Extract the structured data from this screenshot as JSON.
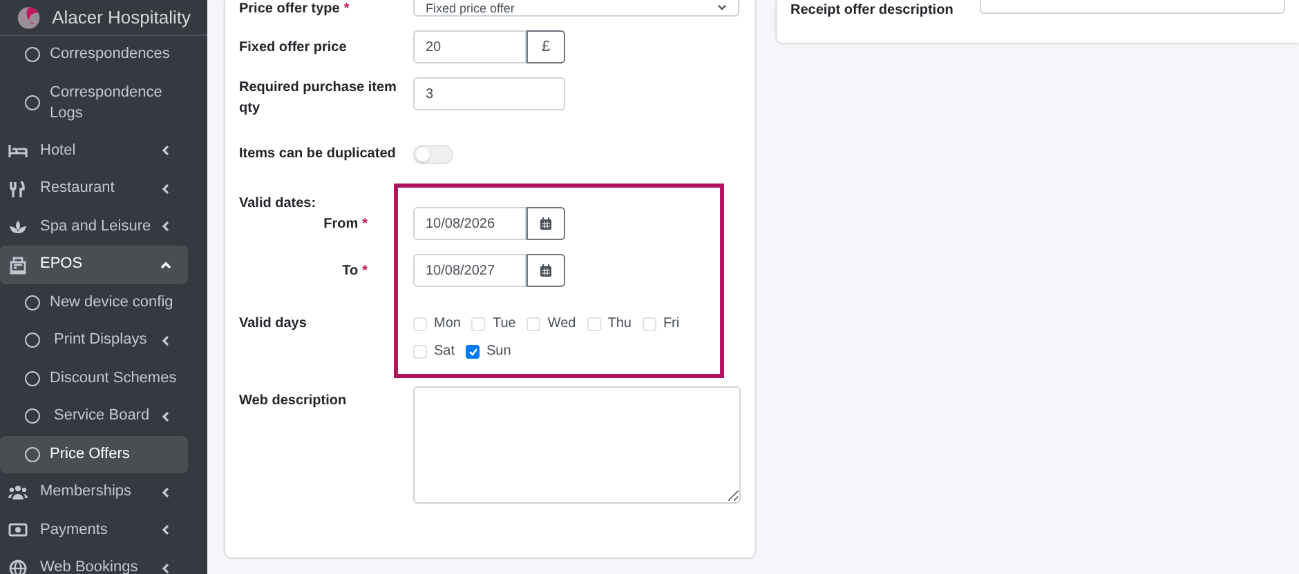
{
  "brand": {
    "name": "Alacer Hospitality"
  },
  "sidebar": {
    "items": [
      {
        "kind": "sub",
        "label": "Correspondences",
        "selected": false
      },
      {
        "kind": "sub",
        "label": "Correspondence Logs",
        "selected": false
      },
      {
        "kind": "main",
        "label": "Hotel",
        "selected": false,
        "expanded": false
      },
      {
        "kind": "main",
        "label": "Restaurant",
        "selected": false,
        "expanded": false
      },
      {
        "kind": "main",
        "label": "Spa and Leisure",
        "selected": false,
        "expanded": false
      },
      {
        "kind": "main",
        "label": "EPOS",
        "selected": true,
        "expanded": true
      },
      {
        "kind": "sub",
        "label": "New device config",
        "selected": false
      },
      {
        "kind": "subgroup",
        "label": "Print Displays",
        "selected": false,
        "expanded": false
      },
      {
        "kind": "sub",
        "label": "Discount Schemes",
        "selected": false
      },
      {
        "kind": "subgroup",
        "label": "Service Board",
        "selected": false,
        "expanded": false
      },
      {
        "kind": "sub",
        "label": "Price Offers",
        "selected": true
      },
      {
        "kind": "main",
        "label": "Memberships",
        "selected": false,
        "expanded": false
      },
      {
        "kind": "main",
        "label": "Payments",
        "selected": false,
        "expanded": false
      },
      {
        "kind": "main",
        "label": "Web Bookings",
        "selected": false,
        "expanded": false
      }
    ]
  },
  "required_mark": "*",
  "form": {
    "price_offer_type": {
      "label": "Price offer type",
      "required": true,
      "value": "Fixed price offer"
    },
    "fixed_offer_price": {
      "label": "Fixed offer price",
      "value": "20",
      "addon": "£"
    },
    "required_qty": {
      "label": "Required purchase item qty",
      "value": "3"
    },
    "duplicated": {
      "label": "Items can be duplicated",
      "on": false
    },
    "valid_dates": {
      "label": "Valid dates:",
      "from": {
        "label": "From",
        "required": true,
        "value": "10/08/2026"
      },
      "to": {
        "label": "To",
        "required": true,
        "value": "10/08/2027"
      }
    },
    "valid_days": {
      "label": "Valid days",
      "days": [
        {
          "label": "Mon",
          "checked": false
        },
        {
          "label": "Tue",
          "checked": false
        },
        {
          "label": "Wed",
          "checked": false
        },
        {
          "label": "Thu",
          "checked": false
        },
        {
          "label": "Fri",
          "checked": false
        },
        {
          "label": "Sat",
          "checked": false
        },
        {
          "label": "Sun",
          "checked": true
        }
      ]
    },
    "web_description": {
      "label": "Web description"
    }
  },
  "side_card": {
    "receipt_description": {
      "label": "Receipt offer description"
    }
  }
}
